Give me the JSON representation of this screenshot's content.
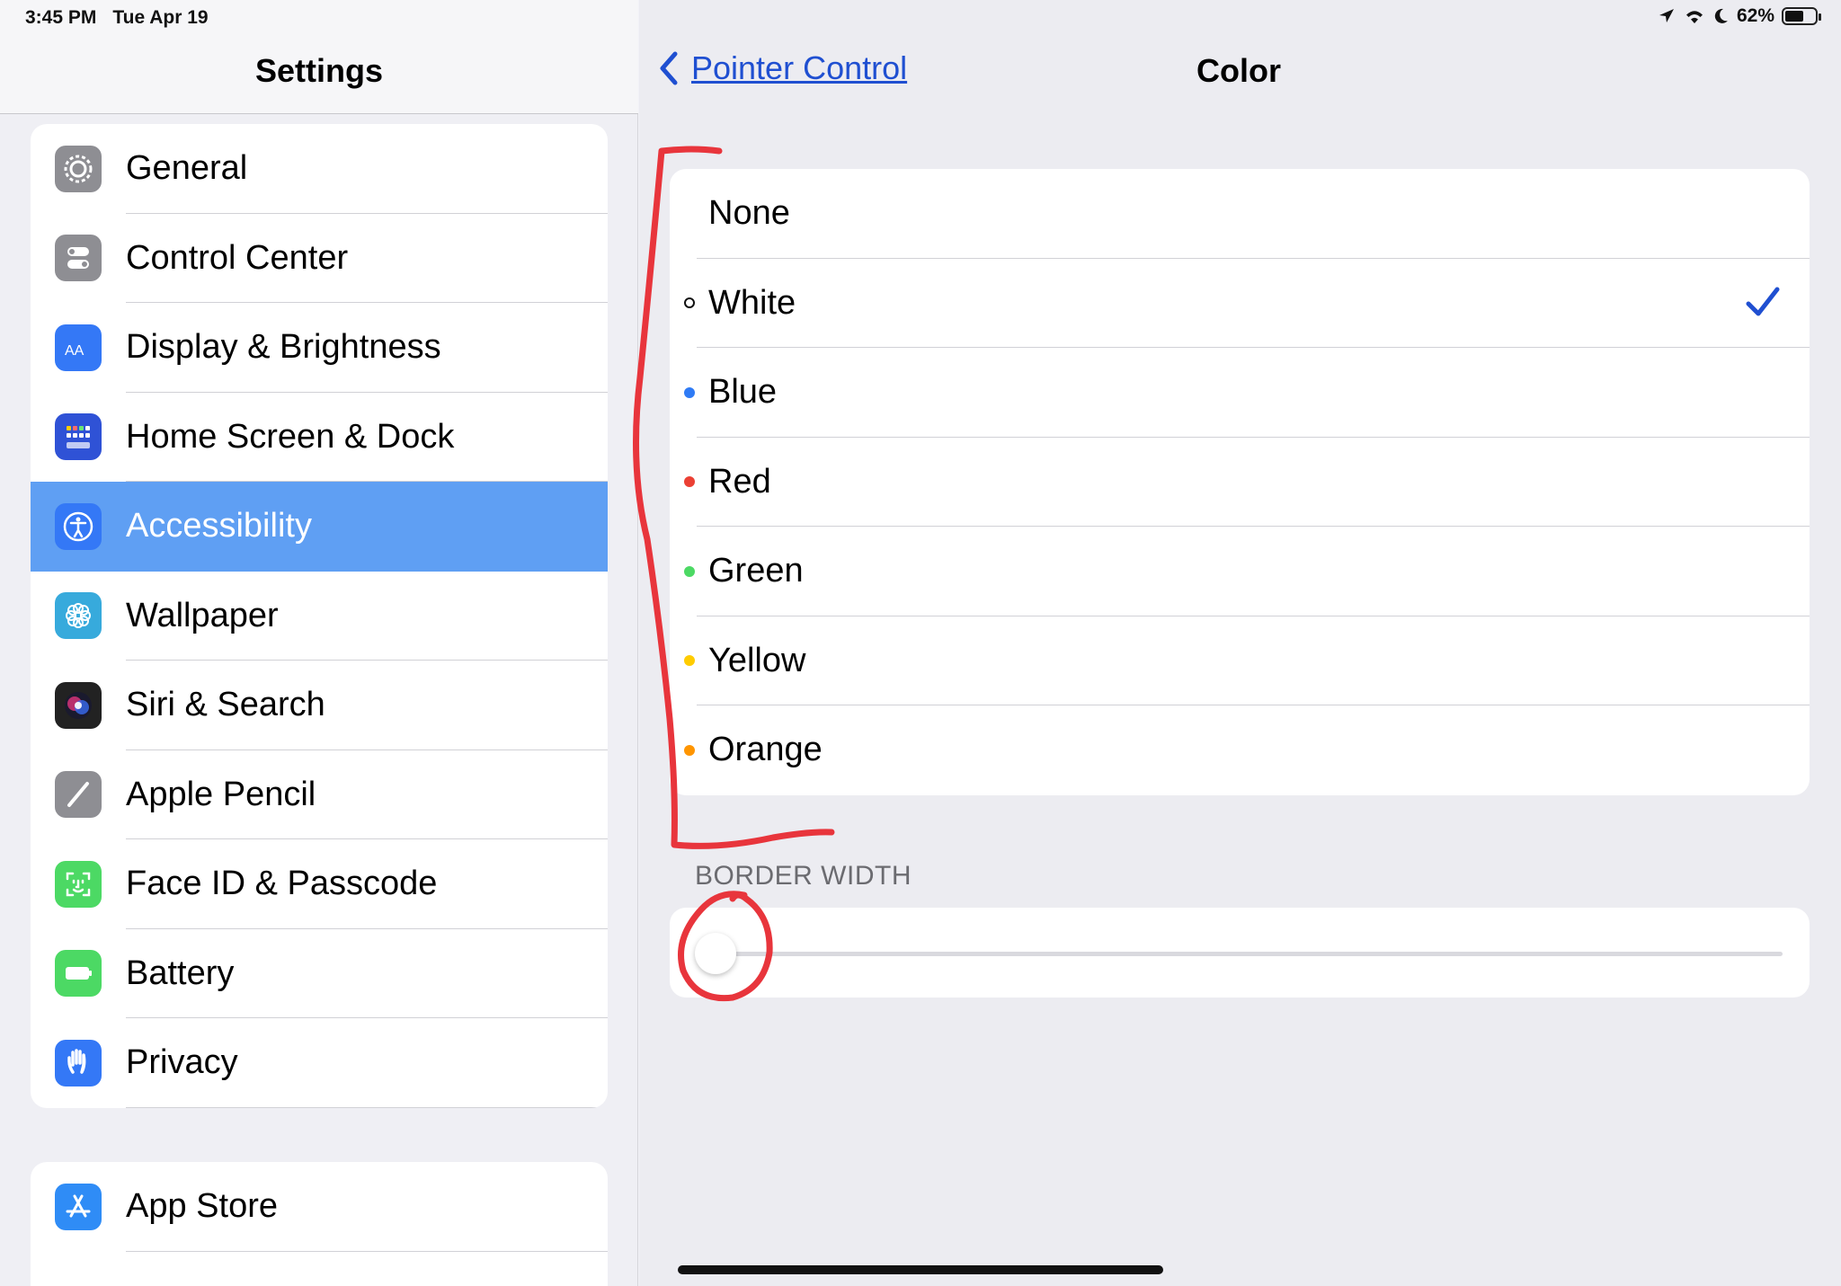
{
  "status": {
    "time": "3:45 PM",
    "date": "Tue Apr 19",
    "battery_text": "62%",
    "battery_level": 0.62
  },
  "left": {
    "title": "Settings",
    "group1": [
      {
        "label": "General",
        "icon": "gear-icon",
        "color": "#8e8e93"
      },
      {
        "label": "Control Center",
        "icon": "toggles-icon",
        "color": "#8e8e93"
      },
      {
        "label": "Display & Brightness",
        "icon": "text-size-icon",
        "color": "#3478f6"
      },
      {
        "label": "Home Screen & Dock",
        "icon": "app-grid-icon",
        "color": "#2f52d6"
      },
      {
        "label": "Accessibility",
        "icon": "accessibility-icon",
        "color": "#3478f6",
        "selected": true
      },
      {
        "label": "Wallpaper",
        "icon": "flower-icon",
        "color": "#37aadc"
      },
      {
        "label": "Siri & Search",
        "icon": "siri-icon",
        "color": "#222"
      },
      {
        "label": "Apple Pencil",
        "icon": "pencil-icon",
        "color": "#8e8e93"
      },
      {
        "label": "Face ID & Passcode",
        "icon": "face-id-icon",
        "color": "#4cd964"
      },
      {
        "label": "Battery",
        "icon": "battery-icon",
        "color": "#4cd964"
      },
      {
        "label": "Privacy",
        "icon": "hand-icon",
        "color": "#3478f6"
      }
    ],
    "group2": [
      {
        "label": "App Store",
        "icon": "app-store-icon",
        "color": "#2f8cf6"
      }
    ]
  },
  "right": {
    "back_label": "Pointer Control",
    "title": "Color",
    "colors": [
      {
        "label": "None",
        "dot": null
      },
      {
        "label": "White",
        "dot": "#ffffff",
        "selected": true
      },
      {
        "label": "Blue",
        "dot": "#2f7bf5"
      },
      {
        "label": "Red",
        "dot": "#eb4034"
      },
      {
        "label": "Green",
        "dot": "#4cd964"
      },
      {
        "label": "Yellow",
        "dot": "#ffcc00"
      },
      {
        "label": "Orange",
        "dot": "#ff9500"
      }
    ],
    "section_label": "BORDER WIDTH",
    "border_width_value": 0.0,
    "accent": "#1f4fd1"
  }
}
